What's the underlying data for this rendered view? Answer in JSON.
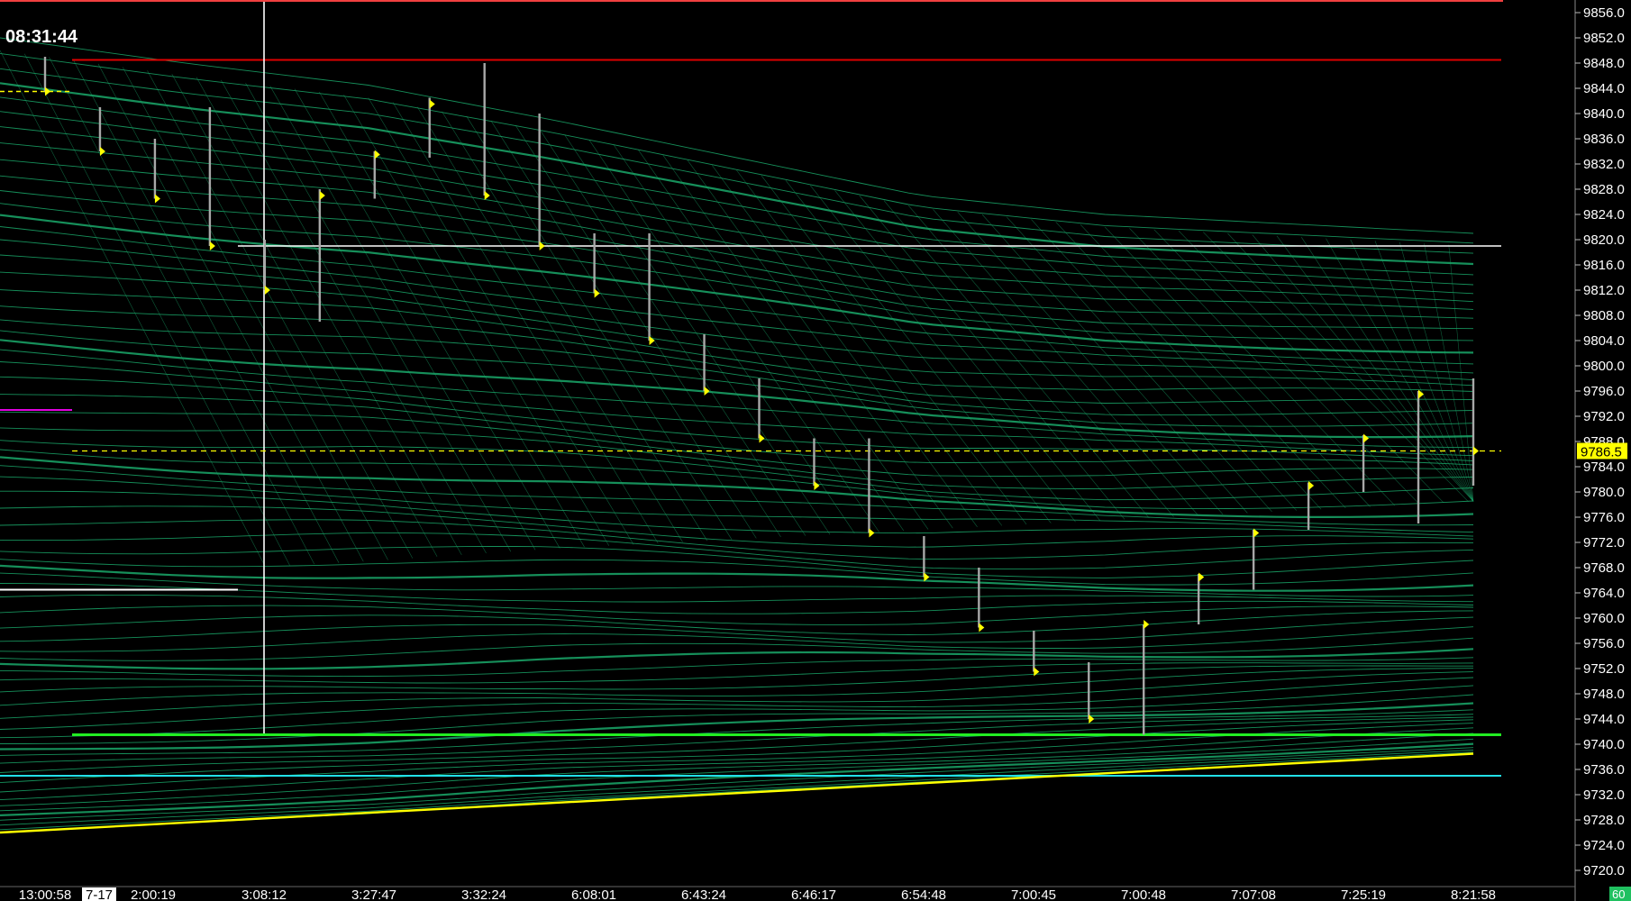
{
  "clock": "08:31:44",
  "colors": {
    "background": "#000000",
    "mesh": "#1aa86a",
    "bar": "#a8a8a8",
    "close_marker": "#ffff00",
    "resistance_line": "#e00000",
    "crosshair": "#ffffff",
    "support_line": "#22ee22",
    "cyan_line": "#22e0e8",
    "lower_band": "#ffff00",
    "last_price_bg": "#ffff00",
    "magenta": "#e000e0",
    "corner_badge_bg": "#20c060"
  },
  "axes": {
    "y_ticks": [
      "9856.0",
      "9852.0",
      "9848.0",
      "9844.0",
      "9840.0",
      "9836.0",
      "9832.0",
      "9828.0",
      "9824.0",
      "9820.0",
      "9816.0",
      "9812.0",
      "9808.0",
      "9804.0",
      "9800.0",
      "9796.0",
      "9792.0",
      "9788.0",
      "9784.0",
      "9780.0",
      "9776.0",
      "9772.0",
      "9768.0",
      "9764.0",
      "9760.0",
      "9756.0",
      "9752.0",
      "9748.0",
      "9744.0",
      "9740.0",
      "9736.0",
      "9732.0",
      "9728.0",
      "9724.0",
      "9720.0"
    ],
    "x_ticks": [
      "13:00:58",
      "7-17",
      "2:00:19",
      "3:08:12",
      "3:27:47",
      "3:32:24",
      "6:08:01",
      "6:43:24",
      "6:46:17",
      "6:54:48",
      "7:00:45",
      "7:00:48",
      "7:07:08",
      "7:25:19",
      "8:21:58"
    ],
    "x_highlight": "7-17",
    "y_min": 9720,
    "y_max": 9856
  },
  "last_price": "9786.5",
  "corner_badge": "60",
  "chart_data": {
    "type": "bar",
    "close_marker": "right-tick",
    "bars": [
      {
        "high": 9849.0,
        "low": 9843.5,
        "close": 9843.5
      },
      {
        "high": 9841.0,
        "low": 9834.0,
        "close": 9834.0
      },
      {
        "high": 9836.0,
        "low": 9826.5,
        "close": 9826.5
      },
      {
        "high": 9841.0,
        "low": 9819.0,
        "close": 9819.0
      },
      {
        "high": 9820.0,
        "low": 9812.0,
        "close": 9812.0
      },
      {
        "high": 9828.0,
        "low": 9807.0,
        "close": 9827.0
      },
      {
        "high": 9834.0,
        "low": 9826.5,
        "close": 9833.5
      },
      {
        "high": 9842.5,
        "low": 9833.0,
        "close": 9841.5
      },
      {
        "high": 9848.0,
        "low": 9827.0,
        "close": 9827.0
      },
      {
        "high": 9840.0,
        "low": 9819.0,
        "close": 9819.0
      },
      {
        "high": 9821.0,
        "low": 9811.5,
        "close": 9811.5
      },
      {
        "high": 9821.0,
        "low": 9804.0,
        "close": 9804.0
      },
      {
        "high": 9805.0,
        "low": 9796.0,
        "close": 9796.0
      },
      {
        "high": 9798.0,
        "low": 9788.5,
        "close": 9788.5
      },
      {
        "high": 9788.5,
        "low": 9781.0,
        "close": 9781.0
      },
      {
        "high": 9788.5,
        "low": 9773.5,
        "close": 9773.5
      },
      {
        "high": 9773.0,
        "low": 9766.5,
        "close": 9766.5
      },
      {
        "high": 9768.0,
        "low": 9758.5,
        "close": 9758.5
      },
      {
        "high": 9758.0,
        "low": 9751.5,
        "close": 9751.5
      },
      {
        "high": 9753.0,
        "low": 9744.0,
        "close": 9744.0
      },
      {
        "high": 9759.0,
        "low": 9741.5,
        "close": 9759.0
      },
      {
        "high": 9767.0,
        "low": 9759.0,
        "close": 9766.5
      },
      {
        "high": 9774.0,
        "low": 9764.5,
        "close": 9773.5
      },
      {
        "high": 9781.5,
        "low": 9774.0,
        "close": 9781.0
      },
      {
        "high": 9789.0,
        "low": 9780.0,
        "close": 9788.5
      },
      {
        "high": 9796.0,
        "low": 9775.0,
        "close": 9795.5
      },
      {
        "high": 9798.0,
        "low": 9781.0,
        "close": 9786.5
      }
    ],
    "levels": {
      "resistance": 9848.5,
      "crosshair_price": 9819.0,
      "support": 9741.5,
      "cyan": 9735.0,
      "prev_close_dashed": 9786.5,
      "left_yellow_dash": 9843.5,
      "left_magenta": 9793.0,
      "left_white": 9764.5
    },
    "lower_band": {
      "start": 9726.0,
      "end": 9738.5
    },
    "mesh": {
      "upper_envelope": [
        9852.0,
        9848.0,
        9844.5,
        9839.0,
        9833.0,
        9827.0,
        9824.0,
        9822.5,
        9821.0
      ],
      "lower_envelope": [
        9726.0,
        9727.5,
        9729.0,
        9731.0,
        9732.5,
        9734.0,
        9735.5,
        9737.0,
        9738.5
      ]
    }
  }
}
